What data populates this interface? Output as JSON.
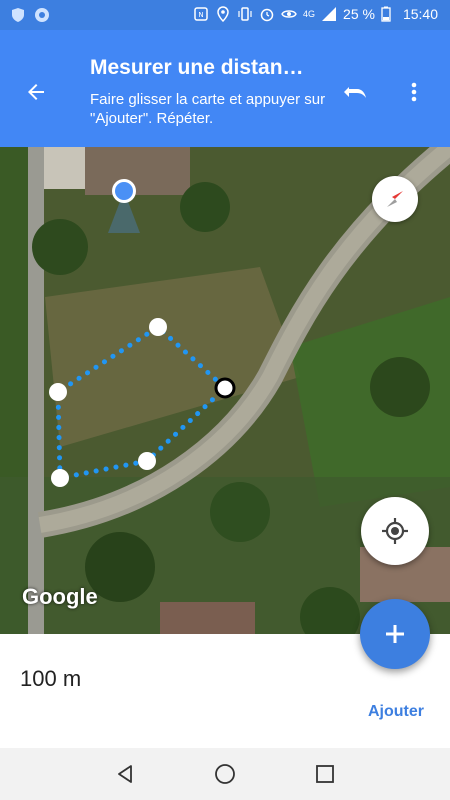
{
  "status_bar": {
    "network": "4G",
    "battery": "25 %",
    "time": "15:40"
  },
  "app_bar": {
    "title": "Mesurer une distan…",
    "subtitle": "Faire glisser la carte et appuyer sur \"Ajouter\". Répéter."
  },
  "map": {
    "attribution": "Google"
  },
  "measurement": {
    "distance": "100 m",
    "add_label": "Ajouter"
  },
  "colors": {
    "primary": "#4287f5",
    "status_bar": "#3d7fe0",
    "measure_line": "#2196f3"
  }
}
